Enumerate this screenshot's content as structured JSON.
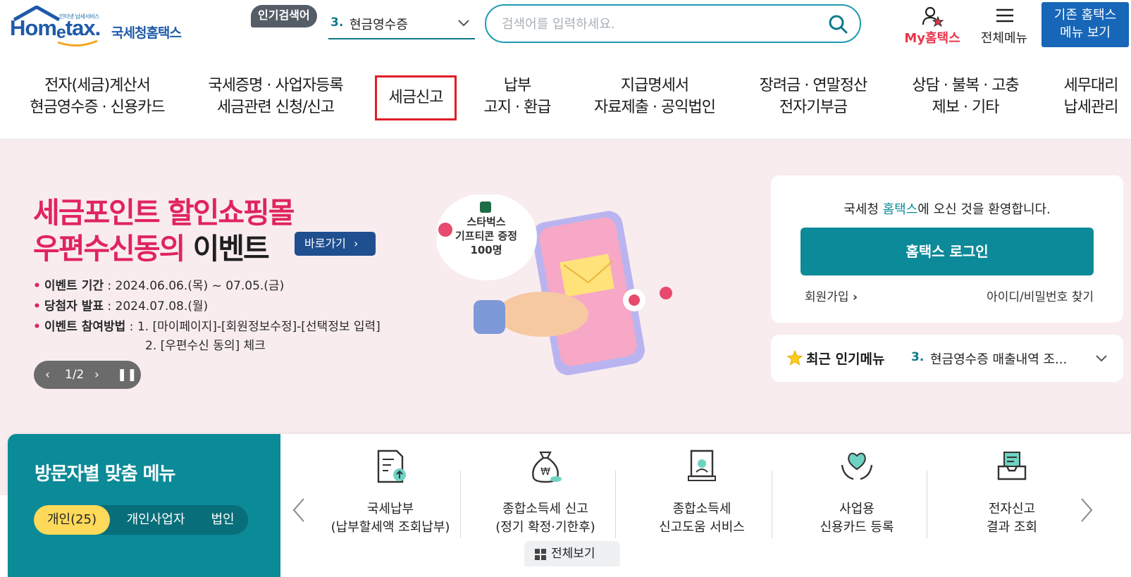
{
  "header": {
    "logo_tagline": "인터넷 납세서비스",
    "logo_brand_a": "Hom",
    "logo_brand_e": "e",
    "logo_brand_b": "tax.",
    "logo_korean": "국세청홈택스",
    "popular_badge": "인기검색어",
    "popular_number": "3.",
    "popular_keyword": "현금영수증",
    "search_placeholder": "검색어를 입력하세요.",
    "my_hometax": "My홈택스",
    "all_menu": "전체메뉴",
    "old_menu_line1": "기존 홈택스",
    "old_menu_line2": "메뉴 보기"
  },
  "gnb": [
    {
      "line1": "전자(세금)계산서",
      "line2": "현금영수증 · 신용카드"
    },
    {
      "line1": "국세증명 · 사업자등록",
      "line2": "세금관련 신청/신고"
    },
    {
      "line1": "세금신고",
      "line2": ""
    },
    {
      "line1": "납부",
      "line2": "고지 · 환급"
    },
    {
      "line1": "지급명세서",
      "line2": "자료제출 · 공익법인"
    },
    {
      "line1": "장려금 · 연말정산",
      "line2": "전자기부금"
    },
    {
      "line1": "상담 · 불복 · 고충",
      "line2": "제보 · 기타"
    },
    {
      "line1": "세무대리",
      "line2": "납세관리"
    }
  ],
  "banner": {
    "title1": "세금포인트 할인쇼핑몰",
    "title2_pink": "우편수신동의 ",
    "title2_black": "이벤트",
    "go_button": "바로가기",
    "line1_label": "이벤트 기간",
    "line1_value": " : 2024.06.06.(목) ~ 07.05.(금)",
    "line2_label": "당첨자 발표",
    "line2_value": " : 2024.07.08.(월)",
    "line3_label": "이벤트 참여방법",
    "line3_value": " : 1. [마이페이지]-[회원정보수정]-[선택정보 입력]",
    "line4_value": "2. [우편수신 동의] 체크",
    "bubble_line1": "스타벅스",
    "bubble_line2": "기프티콘 증정",
    "bubble_line3": "100명",
    "pager": "1/2"
  },
  "login": {
    "welcome_pre": "국세청 ",
    "welcome_hl": "홈택스",
    "welcome_post": "에 오신 것을 환영합니다.",
    "login_button": "홈택스 로그인",
    "join": "회원가입",
    "find": "아이디/비밀번호 찾기"
  },
  "popular_menu": {
    "title": "최근 인기메뉴",
    "number": "3.",
    "text": "현금영수증 매출내역 조..."
  },
  "visitor": {
    "title": "방문자별 맞춤 메뉴",
    "tabs": [
      "개인(25)",
      "개인사업자",
      "법인"
    ],
    "services": [
      {
        "icon": "tax-payment-doc-icon",
        "line1": "국세납부",
        "line2": "(납부할세액 조회납부)"
      },
      {
        "icon": "money-bag-icon",
        "line1": "종합소득세 신고",
        "line2": "(정기 확정·기한후)"
      },
      {
        "icon": "filing-help-icon",
        "line1": "종합소득세",
        "line2": "신고도움 서비스"
      },
      {
        "icon": "heart-hands-icon",
        "line1": "사업용",
        "line2": "신용카드 등록"
      },
      {
        "icon": "inbox-doc-icon",
        "line1": "전자신고",
        "line2": "결과 조회"
      }
    ],
    "view_all": "전체보기"
  },
  "colors": {
    "brand_blue": "#1e5aa8",
    "teal": "#0d8a99",
    "pink": "#e0245e",
    "active_border": "#e01e26",
    "banner_bg": "#f8ecee",
    "tab_active": "#ffd95a"
  }
}
